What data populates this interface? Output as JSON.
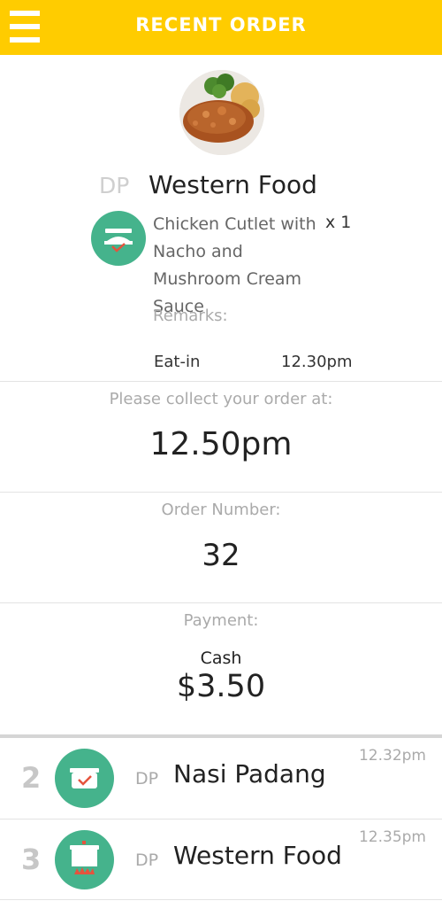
{
  "header": {
    "title": "RECENT ORDER",
    "menu_icon": "hamburger-menu-icon"
  },
  "order": {
    "stall_code": "DP",
    "stall_name": "Western Food",
    "item": {
      "name": "Chicken Cutlet with Nacho and Mushroom Cream Sauce",
      "quantity": "x 1",
      "icon": "serving-dish-check-icon"
    },
    "remarks_label": "Remarks:",
    "dine_type": "Eat-in",
    "order_time": "12.30pm"
  },
  "collect": {
    "label": "Please collect your order at:",
    "time": "12.50pm"
  },
  "order_number": {
    "label": "Order Number:",
    "value": "32"
  },
  "payment": {
    "label": "Payment:",
    "method": "Cash",
    "amount": "$3.50"
  },
  "queue": [
    {
      "number": "2",
      "code": "DP",
      "name": "Nasi Padang",
      "time": "12.32pm",
      "icon": "ready-dish-check-icon"
    },
    {
      "number": "3",
      "code": "DP",
      "name": "Western Food",
      "time": "12.35pm",
      "icon": "cooking-pot-icon"
    }
  ],
  "colors": {
    "header": "#ffcc00",
    "icon_green": "#45b38c",
    "check_red": "#e5533d"
  }
}
